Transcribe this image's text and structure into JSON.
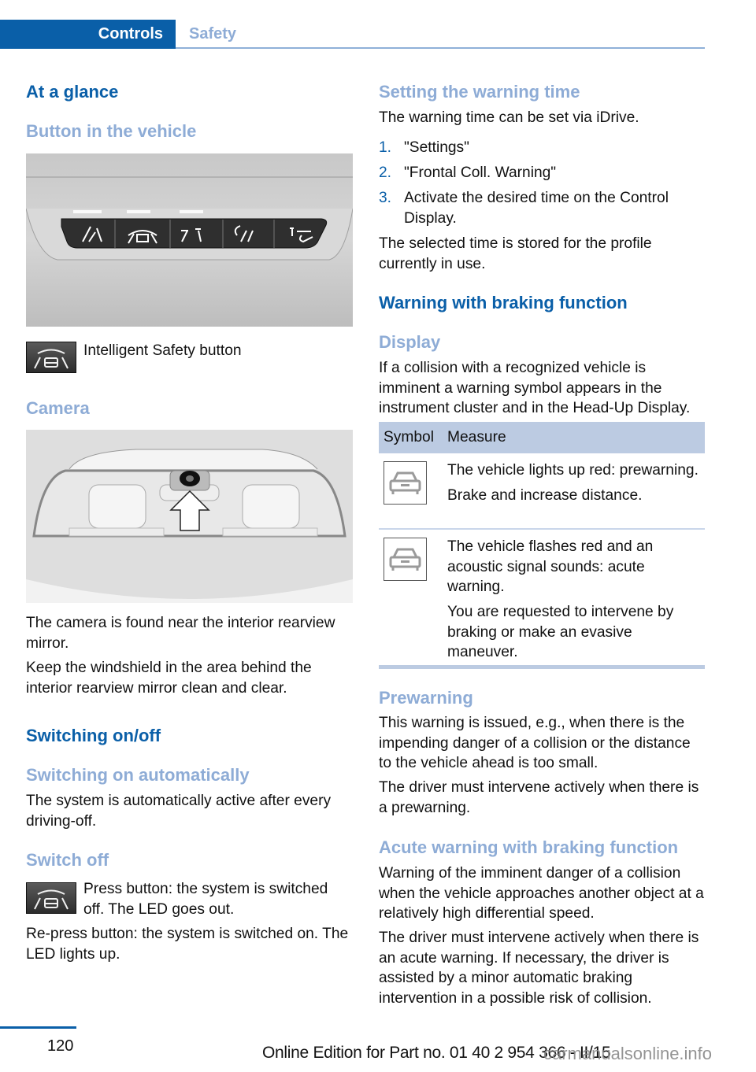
{
  "header": {
    "tabs": [
      {
        "label": "Controls",
        "active": true
      },
      {
        "label": "Safety",
        "active": false
      }
    ]
  },
  "left": {
    "at_a_glance": "At a glance",
    "button_in_vehicle": "Button in the vehicle",
    "button_panel_image": "Overhead button panel with five buttons",
    "intelligent_safety_button": "Intelligent Safety button",
    "camera_heading": "Camera",
    "camera_image": "Windshield view with camera near interior rearview mirror",
    "camera_p1": "The camera is found near the interior rearview mirror.",
    "camera_p2": "Keep the windshield in the area behind the interior rearview mirror clean and clear.",
    "switching_on_off": "Switching on/off",
    "switching_on_auto": "Switching on automatically",
    "auto_p": "The system is automatically active after every driving-off.",
    "switch_off": "Switch off",
    "switch_off_p": "Press button: the system is switched off. The LED goes out.",
    "repress_p": "Re-press button: the system is switched on. The LED lights up."
  },
  "right": {
    "setting_warning_time": "Setting the warning time",
    "setting_p": "The warning time can be set via iDrive.",
    "steps": [
      {
        "num": "1.",
        "text": "\"Settings\""
      },
      {
        "num": "2.",
        "text": "\"Frontal Coll. Warning\""
      },
      {
        "num": "3.",
        "text": "Activate the desired time on the Control Display."
      }
    ],
    "stored_p": "The selected time is stored for the profile currently in use.",
    "warning_braking": "Warning with braking function",
    "display": "Display",
    "display_p": "If a collision with a recognized vehicle is imminent a warning symbol appears in the instrument cluster and in the Head-Up Display.",
    "table": {
      "headers": [
        "Symbol",
        "Measure"
      ],
      "rows": [
        {
          "symbol": "vehicle-warning-icon",
          "measure": [
            "The vehicle lights up red: prewarning.",
            "Brake and increase distance."
          ]
        },
        {
          "symbol": "vehicle-warning-icon",
          "measure": [
            "The vehicle flashes red and an acoustic signal sounds: acute warning.",
            "You are requested to intervene by braking or make an evasive maneuver."
          ]
        }
      ]
    },
    "prewarning": "Prewarning",
    "prewarning_p1": "This warning is issued, e.g., when there is the impending danger of a collision or the distance to the vehicle ahead is too small.",
    "prewarning_p2": "The driver must intervene actively when there is a prewarning.",
    "acute": "Acute warning with braking function",
    "acute_p1": "Warning of the imminent danger of a collision when the vehicle approaches another object at a relatively high differential speed.",
    "acute_p2": "The driver must intervene actively when there is an acute warning. If necessary, the driver is assisted by a minor automatic braking intervention in a possible risk of collision."
  },
  "footer": {
    "page_number": "120",
    "edition": "Online Edition for Part no. 01 40 2 954 366 - II/15",
    "watermark": "carmanualsonline.info"
  }
}
